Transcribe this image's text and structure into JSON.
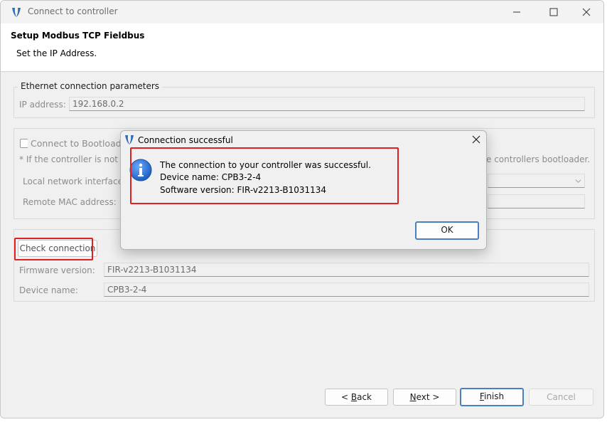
{
  "window": {
    "title": "Connect to controller"
  },
  "header": {
    "title": "Setup Modbus TCP Fieldbus",
    "subtitle": "Set the IP Address."
  },
  "ethernet": {
    "legend": "Ethernet connection parameters",
    "ip_label": "IP address:",
    "ip_value": "192.168.0.2"
  },
  "bootloader": {
    "checkbox_label": "Connect to Bootloade",
    "note_left": "* If the controller is not r",
    "note_right": "e controllers bootloader.",
    "local_nic_label": "Local network interface:",
    "remote_mac_label": "Remote MAC address:"
  },
  "check": {
    "button_label": "Check connection",
    "firmware_label": "Firmware version:",
    "firmware_value": "FIR-v2213-B1031134",
    "device_label": "Device name:",
    "device_value": "CPB3-2-4"
  },
  "footer": {
    "back": "< Back",
    "next": "Next >",
    "finish": "Finish",
    "cancel": "Cancel"
  },
  "dialog": {
    "title": "Connection successful",
    "message_1": "The connection to your controller was successful.",
    "message_2": "Device name: CPB3-2-4",
    "message_3": "Software version: FIR-v2213-B1031134",
    "ok": "OK"
  },
  "colors": {
    "accent": "#4a7fc1",
    "highlight": "#e02020",
    "info_icon": "#1f5fbf"
  },
  "icons": [
    "app-logo-icon",
    "minimize-icon",
    "maximize-icon",
    "close-icon",
    "info-icon",
    "chevron-down-icon"
  ]
}
